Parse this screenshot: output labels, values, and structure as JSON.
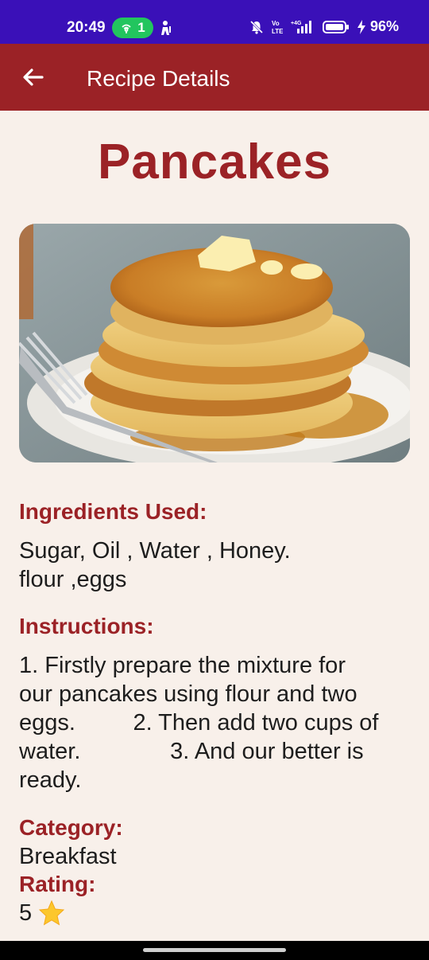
{
  "status_bar": {
    "time": "20:49",
    "hotspot_count": "1",
    "battery": "96%",
    "network": "4G",
    "volte": "Vo LTE",
    "icons": [
      "hotspot-icon",
      "person-icon",
      "mute-icon",
      "volte-icon",
      "signal-icon",
      "battery-icon",
      "charging-icon"
    ]
  },
  "app_bar": {
    "title": "Recipe Details",
    "back_icon": "arrow-left-icon",
    "background_color": "#9b2226"
  },
  "recipe": {
    "name": "Pancakes",
    "image_alt": "stack of pancakes with butter and syrup",
    "ingredients_heading": "Ingredients Used:",
    "ingredients_text": "Sugar, Oil , Water , Honey.\nflour ,eggs",
    "instructions_heading": "Instructions:",
    "instructions_text": "1. Firstly prepare the mixture for\nour pancakes using flour and two\neggs.         2. Then add two cups of\nwater.              3. And our better is\nready.",
    "category_heading": "Category:",
    "category_value": "Breakfast",
    "rating_heading": "Rating:",
    "rating_value": "5",
    "rating_icon": "star-icon"
  },
  "colors": {
    "accent": "#9b2226",
    "page_background": "#f8f0ea",
    "status_bar": "#3a10b8"
  }
}
